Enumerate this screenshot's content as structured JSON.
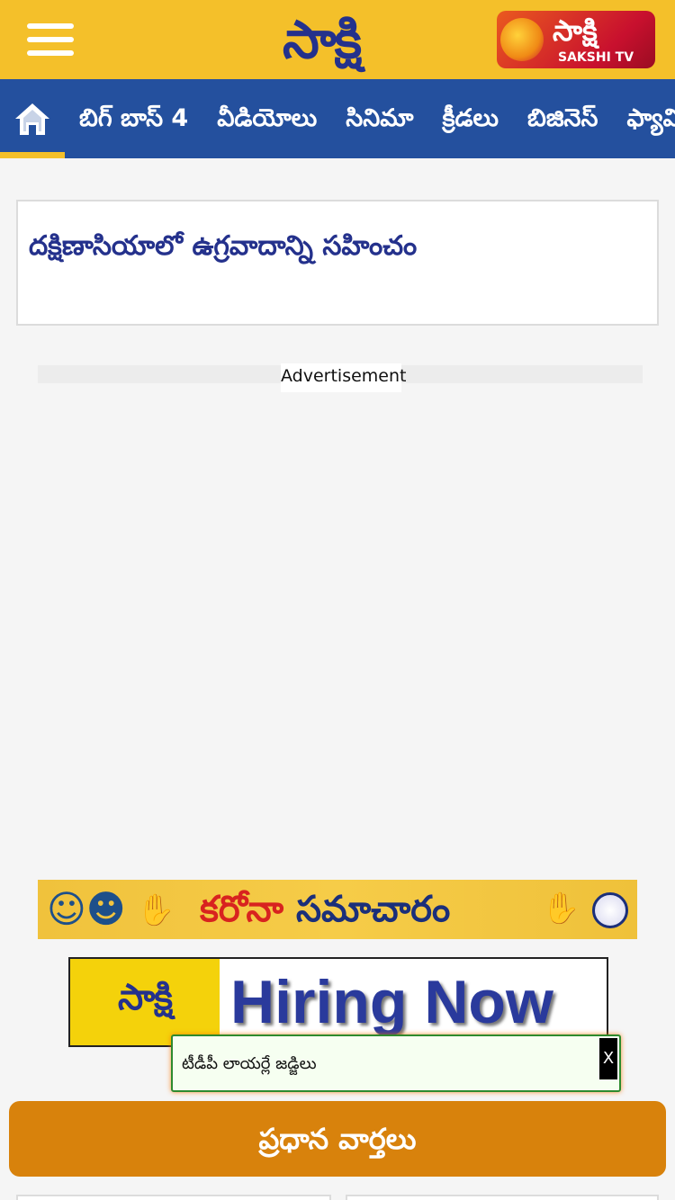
{
  "header": {
    "logo_text": "సాక్షి",
    "tv_logo_text": "సాక్షి",
    "tv_logo_sub": "SAKSHI TV"
  },
  "nav": {
    "items": [
      {
        "label": "బిగ్ బాస్ 4"
      },
      {
        "label": "వీడియోలు"
      },
      {
        "label": "సినిమా"
      },
      {
        "label": "క్రీడలు"
      },
      {
        "label": "బిజినెస్"
      },
      {
        "label": "ఫ్యామిలీ"
      }
    ]
  },
  "article": {
    "headline": "దక్షిణాసియాలో ఉగ్రవాదాన్ని సహించం"
  },
  "ad": {
    "label": "Advertisement"
  },
  "banners": {
    "corona_red": "కరోనా",
    "corona_blue": "సమాచారం",
    "hiring_logo": "సాక్షి",
    "hiring_text": "Hiring Now"
  },
  "toast": {
    "text": "టీడీపీ లాయర్లే జడ్జిలు",
    "close_label": "X"
  },
  "section": {
    "top_news": "ప్రధాన వార్తలు"
  },
  "colors": {
    "header_bg": "#f4c02a",
    "nav_bg": "#24509e",
    "brand_blue": "#24318c",
    "top_news_bg": "#d8820c"
  }
}
